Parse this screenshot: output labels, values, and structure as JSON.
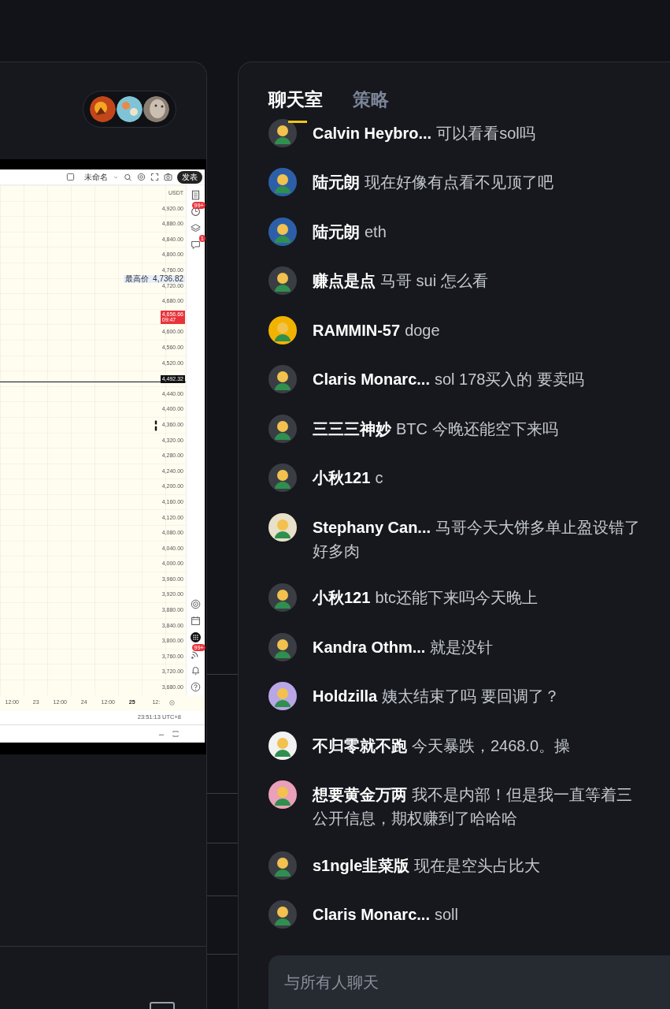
{
  "left_panel": {
    "participants": [
      {
        "kind": "fire"
      },
      {
        "kind": "map"
      },
      {
        "kind": "stone"
      }
    ],
    "chart_screenshot": {
      "toolbar": {
        "title": "未命名",
        "publish_button": "发表"
      },
      "price_axis": [
        {
          "label": "USDT"
        },
        {
          "label": "4,920.00"
        },
        {
          "label": "4,880.00"
        },
        {
          "label": "4,840.00"
        },
        {
          "label": "4,800.00"
        },
        {
          "label": "4,760.00"
        },
        {
          "label": "4,720.00",
          "tag": {
            "kind": "high",
            "name": "最高价",
            "value": "4,736.82"
          }
        },
        {
          "label": "4,680.00"
        },
        {
          "tag": {
            "kind": "last",
            "value": "4,656.66",
            "time": "09:47"
          }
        },
        {
          "label": "4,600.00"
        },
        {
          "label": "4,560.00"
        },
        {
          "label": "4,520.00"
        },
        {
          "tag": {
            "kind": "line",
            "value": "4,492.32"
          }
        },
        {
          "label": "4,440.00"
        },
        {
          "label": "4,400.00"
        },
        {
          "label": "4,360.00",
          "candles": true
        },
        {
          "label": "4,320.00"
        },
        {
          "label": "4,280.00"
        },
        {
          "label": "4,240.00"
        },
        {
          "label": "4,200.00"
        },
        {
          "label": "4,160.00"
        },
        {
          "label": "4,120.00"
        },
        {
          "label": "4,080.00"
        },
        {
          "label": "4,040.00"
        },
        {
          "label": "4,000.00"
        },
        {
          "label": "3,960.00"
        },
        {
          "label": "3,920.00"
        },
        {
          "label": "3,880.00"
        },
        {
          "label": "3,840.00"
        },
        {
          "label": "3,800.00"
        },
        {
          "label": "3,760.00"
        },
        {
          "label": "3,720.00"
        },
        {
          "label": "3,680.00"
        }
      ],
      "time_axis": [
        {
          "label": "12:00",
          "bold": false
        },
        {
          "label": "23",
          "bold": false
        },
        {
          "label": "12:00",
          "bold": false
        },
        {
          "label": "24",
          "bold": false
        },
        {
          "label": "12:00",
          "bold": false
        },
        {
          "label": "25",
          "bold": true
        },
        {
          "label": "12:",
          "bold": false
        }
      ],
      "clock": "23:51:13 UTC+8",
      "side_badges": {
        "alerts": "99+",
        "chat": "1",
        "signals": "99+"
      }
    }
  },
  "chat": {
    "tabs": [
      {
        "label": "聊天室",
        "selected": true
      },
      {
        "label": "策略",
        "selected": false
      }
    ],
    "messages": [
      {
        "name": "Calvin Heybro...",
        "text": "可以看看sol吗",
        "color": "#3a3d44"
      },
      {
        "name": "陆元朗",
        "text": "现在好像有点看不见顶了吧",
        "color": "#2d5fa8"
      },
      {
        "name": "陆元朗",
        "text": "eth",
        "color": "#2d5fa8"
      },
      {
        "name": "赚点是点",
        "text": "马哥 sui 怎么看",
        "color": "#3a3d44"
      },
      {
        "name": "RAMMIN-57",
        "text": "doge",
        "color": "#f2b300"
      },
      {
        "name": "Claris Monarc...",
        "text": "sol 178买入的 要卖吗",
        "color": "#3a3d44"
      },
      {
        "name": "三三三神妙",
        "text": "BTC 今晚还能空下来吗",
        "color": "#3a3d44"
      },
      {
        "name": "小秋121",
        "text": "c",
        "color": "#3a3d44"
      },
      {
        "name": "Stephany Can...",
        "text": "马哥今天大饼多单止盈设错了",
        "more": "好多肉",
        "color": "#e8e0c8"
      },
      {
        "name": "小秋121",
        "text": "btc还能下来吗今天晚上",
        "color": "#3a3d44"
      },
      {
        "name": "Kandra Othm...",
        "text": "就是没针",
        "color": "#3a3d44"
      },
      {
        "name": "Holdzilla",
        "text": "姨太结束了吗 要回调了？",
        "color": "#b9a6e6"
      },
      {
        "name": "不归零就不跑",
        "text": "今天暴跌，2468.0。操",
        "color": "#f2f2f2"
      },
      {
        "name": "想要黄金万两",
        "text": "我不是内部！但是我一直等着三",
        "more": "公开信息，期权赚到了哈哈哈",
        "color": "#e9a0b8"
      },
      {
        "name": "s1ngle韭菜版",
        "text": "现在是空头占比大",
        "color": "#3a3d44"
      },
      {
        "name": "Claris Monarc...",
        "text": "soll",
        "color": "#3a3d44"
      }
    ],
    "input": {
      "placeholder": "与所有人聊天"
    }
  }
}
